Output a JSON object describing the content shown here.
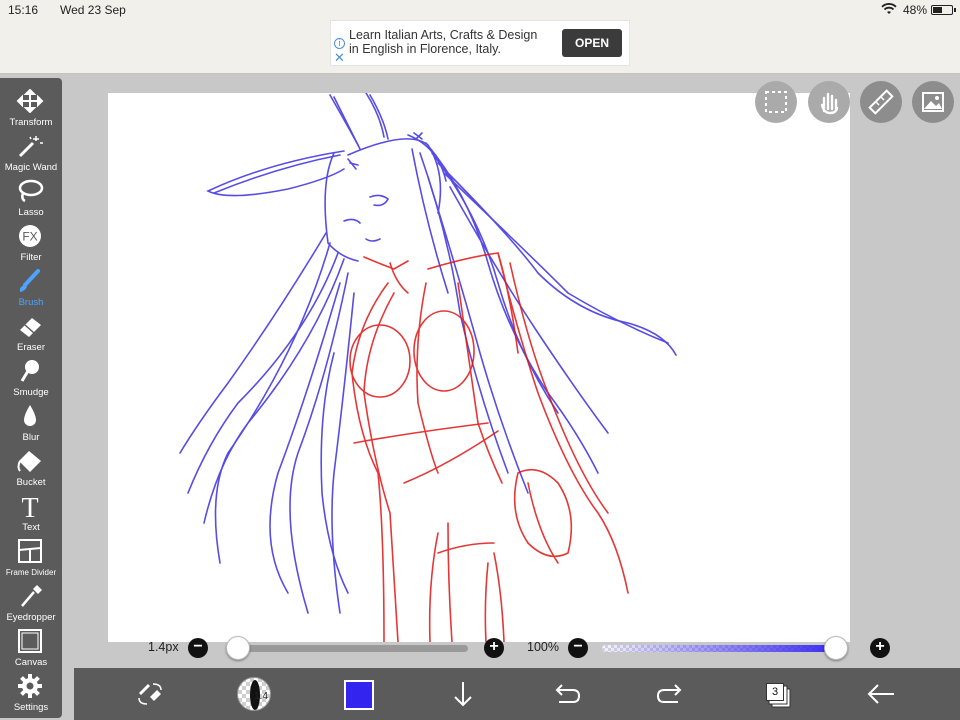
{
  "status_bar": {
    "time": "15:16",
    "date": "Wed 23 Sep",
    "battery": "48%"
  },
  "ad": {
    "line1": "Learn Italian Arts, Crafts & Design",
    "line2": "in English in Florence, Italy.",
    "cta": "OPEN",
    "info_icon": "info-icon",
    "close_icon": "close-icon"
  },
  "toolbar": {
    "active": "Brush",
    "active_color": "#4da3ff",
    "tools": [
      {
        "label": "Transform",
        "icon": "move-arrows-icon"
      },
      {
        "label": "Magic Wand",
        "icon": "magic-wand-icon"
      },
      {
        "label": "Lasso",
        "icon": "lasso-icon"
      },
      {
        "label": "Filter",
        "icon": "fx-icon"
      },
      {
        "label": "Brush",
        "icon": "brush-icon"
      },
      {
        "label": "Eraser",
        "icon": "eraser-icon"
      },
      {
        "label": "Smudge",
        "icon": "smudge-icon"
      },
      {
        "label": "Blur",
        "icon": "blur-drop-icon"
      },
      {
        "label": "Bucket",
        "icon": "bucket-icon"
      },
      {
        "label": "Text",
        "icon": "text-icon"
      },
      {
        "label": "Frame Divider",
        "icon": "frame-divider-icon"
      },
      {
        "label": "Eyedropper",
        "icon": "eyedropper-icon"
      },
      {
        "label": "Canvas",
        "icon": "canvas-icon"
      },
      {
        "label": "Settings",
        "icon": "gear-icon"
      }
    ]
  },
  "floating_buttons": [
    "selection-icon",
    "hand-icon",
    "ruler-icon",
    "image-icon"
  ],
  "sliders": {
    "brush_size_label": "1.4px",
    "brush_size_fraction": 0.0,
    "opacity_label": "100%",
    "opacity_fraction": 1.0
  },
  "bottom_bar": {
    "brush_number": "1.4",
    "current_color": "#3324f0",
    "layer_count": "3",
    "icons": [
      "swap-brush-eraser-icon",
      "brush-preview",
      "color-swatch",
      "download-arrow-icon",
      "undo-icon",
      "redo-icon",
      "layers-icon",
      "back-arrow-icon"
    ]
  },
  "sketch_colors": {
    "hair": "#3a2ee0",
    "body": "#e01515"
  }
}
